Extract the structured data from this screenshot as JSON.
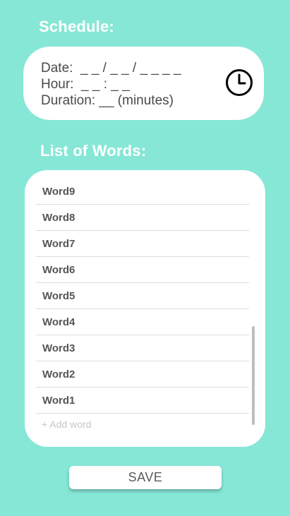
{
  "schedule": {
    "title": "Schedule:",
    "date_line": "Date:  _ _ / _ _ / _ _ _ _",
    "hour_line": "Hour:  _ _ : _ _",
    "duration_line": "Duration: __ (minutes)",
    "icon": "clock-icon"
  },
  "words": {
    "title": "List of Words:",
    "items": [
      {
        "label": "Word9"
      },
      {
        "label": "Word8"
      },
      {
        "label": "Word7"
      },
      {
        "label": "Word6"
      },
      {
        "label": "Word5"
      },
      {
        "label": "Word4"
      },
      {
        "label": "Word3"
      },
      {
        "label": "Word2"
      },
      {
        "label": "Word1"
      }
    ],
    "add_placeholder": "+ Add word"
  },
  "save_label": "SAVE",
  "colors": {
    "background": "#86E7D6",
    "card": "#FFFFFF",
    "text": "#4A4A4A"
  }
}
